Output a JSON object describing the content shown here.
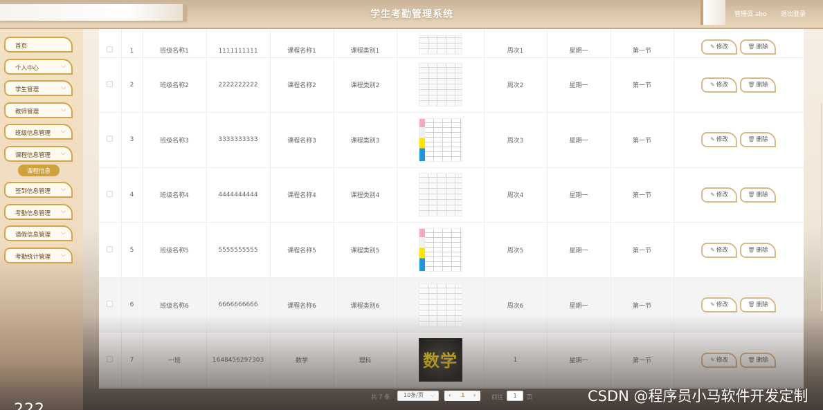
{
  "header": {
    "title": "学生考勤管理系统",
    "admin_label": "管理员 abo",
    "logout_label": "退出登录"
  },
  "sidebar": {
    "items": [
      {
        "label": "首页",
        "has_arrow": false
      },
      {
        "label": "个人中心",
        "has_arrow": true
      },
      {
        "label": "学生管理",
        "has_arrow": true
      },
      {
        "label": "教师管理",
        "has_arrow": true
      },
      {
        "label": "班级信息管理",
        "has_arrow": true
      },
      {
        "label": "课程信息管理",
        "has_arrow": true
      },
      {
        "label": "签到信息管理",
        "has_arrow": true
      },
      {
        "label": "考勤信息管理",
        "has_arrow": true
      },
      {
        "label": "请假信息管理",
        "has_arrow": true
      },
      {
        "label": "考勤统计管理",
        "has_arrow": true
      }
    ],
    "active_sub_item": "课程信息",
    "chevron": "chevron-down-icon"
  },
  "table": {
    "rows": [
      {
        "idx": "1",
        "class_name": "班级名称1",
        "number": "1111111111",
        "course_name": "课程名称1",
        "course_type": "课程类别1",
        "image": "schedule-sketch",
        "week": "周次1",
        "day": "星期一",
        "period": "第一节"
      },
      {
        "idx": "2",
        "class_name": "班级名称2",
        "number": "2222222222",
        "course_name": "课程名称2",
        "course_type": "课程类别2",
        "image": "schedule-sketch",
        "week": "周次2",
        "day": "星期一",
        "period": "第一节"
      },
      {
        "idx": "3",
        "class_name": "班级名称3",
        "number": "3333333333",
        "course_name": "课程名称3",
        "course_type": "课程类别3",
        "image": "schedule-color",
        "week": "周次3",
        "day": "星期一",
        "period": "第一节"
      },
      {
        "idx": "4",
        "class_name": "班级名称4",
        "number": "4444444444",
        "course_name": "课程名称4",
        "course_type": "课程类别4",
        "image": "schedule-sketch",
        "week": "周次4",
        "day": "星期一",
        "period": "第一节"
      },
      {
        "idx": "5",
        "class_name": "班级名称5",
        "number": "5555555555",
        "course_name": "课程名称5",
        "course_type": "课程类别5",
        "image": "schedule-color",
        "week": "周次5",
        "day": "星期一",
        "period": "第一节"
      },
      {
        "idx": "6",
        "class_name": "班级名称6",
        "number": "6666666666",
        "course_name": "课程名称6",
        "course_type": "课程类别6",
        "image": "schedule-sketch",
        "week": "周次6",
        "day": "星期一",
        "period": "第一节"
      },
      {
        "idx": "7",
        "class_name": "一班",
        "number": "1648456297303",
        "course_name": "数学",
        "course_type": "理科",
        "image": "math-chalkboard",
        "image_text": "数学",
        "week": "1",
        "day": "星期一",
        "period": "第一节"
      }
    ],
    "edit_label": "修改",
    "delete_label": "删除",
    "edit_icon": "edit-icon",
    "delete_icon": "trash-icon"
  },
  "pagination": {
    "total": "共 7 条",
    "page_size": "10条/页",
    "current_page": "1",
    "goto_label": "前往",
    "goto_value": "1",
    "page_unit": "页"
  },
  "watermark": "CSDN @程序员小马软件开发定制",
  "corner_text": "222",
  "colors": {
    "accent": "#d2a648",
    "active_sub": "#cfa13e",
    "header_title": "#ffffff",
    "button_border": "#d9b98c"
  }
}
